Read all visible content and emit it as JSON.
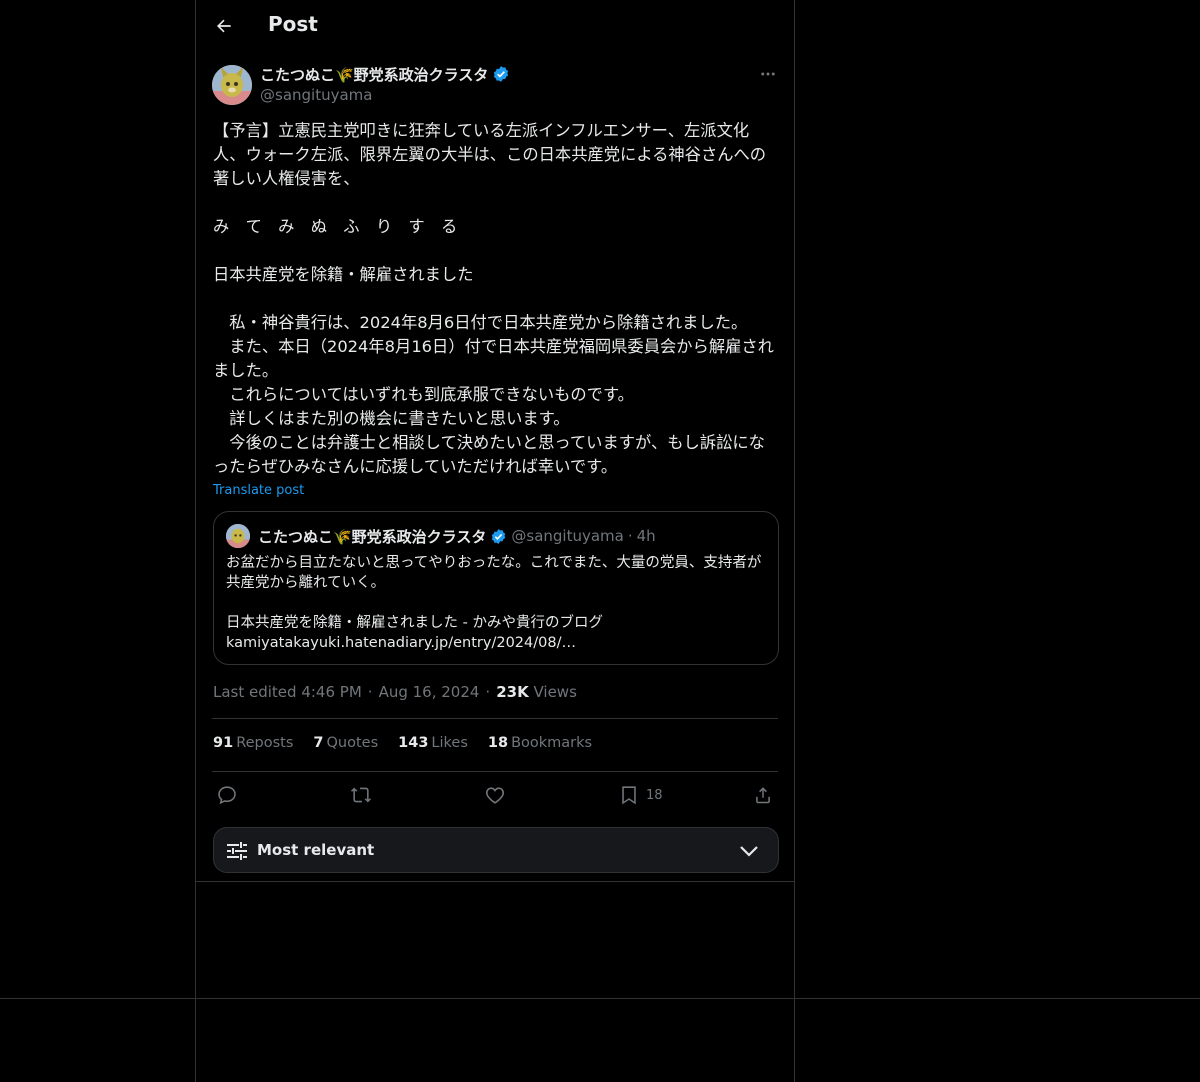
{
  "header": {
    "title": "Post"
  },
  "post": {
    "author_name": "こたつぬこ🌾野党系政治クラスタ",
    "author_handle": "@sangituyama",
    "text": "【予言】立憲民主党叩きに狂奔している左派インフルエンサー、左派文化人、ウォーク左派、限界左翼の大半は、この日本共産党による神谷さんへの著しい人権侵害を、\n\nみ　て　み　ぬ　ふ　り　す　る\n\n日本共産党を除籍・解雇されました\n\n　私・神谷貴行は、2024年8月6日付で日本共産党から除籍されました。\n　また、本日（2024年8月16日）付で日本共産党福岡県委員会から解雇されました。\n　これらについてはいずれも到底承服できないものです。\n　詳しくはまた別の機会に書きたいと思います。\n　今後のことは弁護士と相談して決めたいと思っていますが、もし訴訟になったらぜひみなさんに応援していただければ幸いです。",
    "translate_label": "Translate post"
  },
  "quote": {
    "author_name": "こたつぬこ🌾野党系政治クラスタ",
    "author_handle": "@sangituyama",
    "separator": "·",
    "time": "4h",
    "text": "お盆だから目立たないと思ってやりおったな。これでまた、大量の党員、支持者が共産党から離れていく。\n\n日本共産党を除籍・解雇されました - かみや貴行のブログ\nkamiyatakayuki.hatenadiary.jp/entry/2024/08/…"
  },
  "meta": {
    "edited": "Last edited 4:46 PM",
    "sep1": "·",
    "date": "Aug 16, 2024",
    "sep2": "·",
    "views_count": "23K",
    "views_label": "Views"
  },
  "stats": {
    "reposts_count": "91",
    "reposts_label": "Reposts",
    "quotes_count": "7",
    "quotes_label": "Quotes",
    "likes_count": "143",
    "likes_label": "Likes",
    "bookmarks_count": "18",
    "bookmarks_label": "Bookmarks"
  },
  "actions": {
    "bookmark_count": "18"
  },
  "sort": {
    "label": "Most relevant"
  },
  "colors": {
    "background": "#000000",
    "text": "#e7e9ea",
    "muted": "#71767b",
    "accent": "#1d9bf0",
    "border": "#2f3336"
  },
  "icons": [
    "back-arrow-icon",
    "more-icon",
    "verified-badge-icon",
    "reply-icon",
    "repost-icon",
    "like-icon",
    "bookmark-icon",
    "share-icon",
    "sort-sliders-icon",
    "chevron-down-icon"
  ]
}
